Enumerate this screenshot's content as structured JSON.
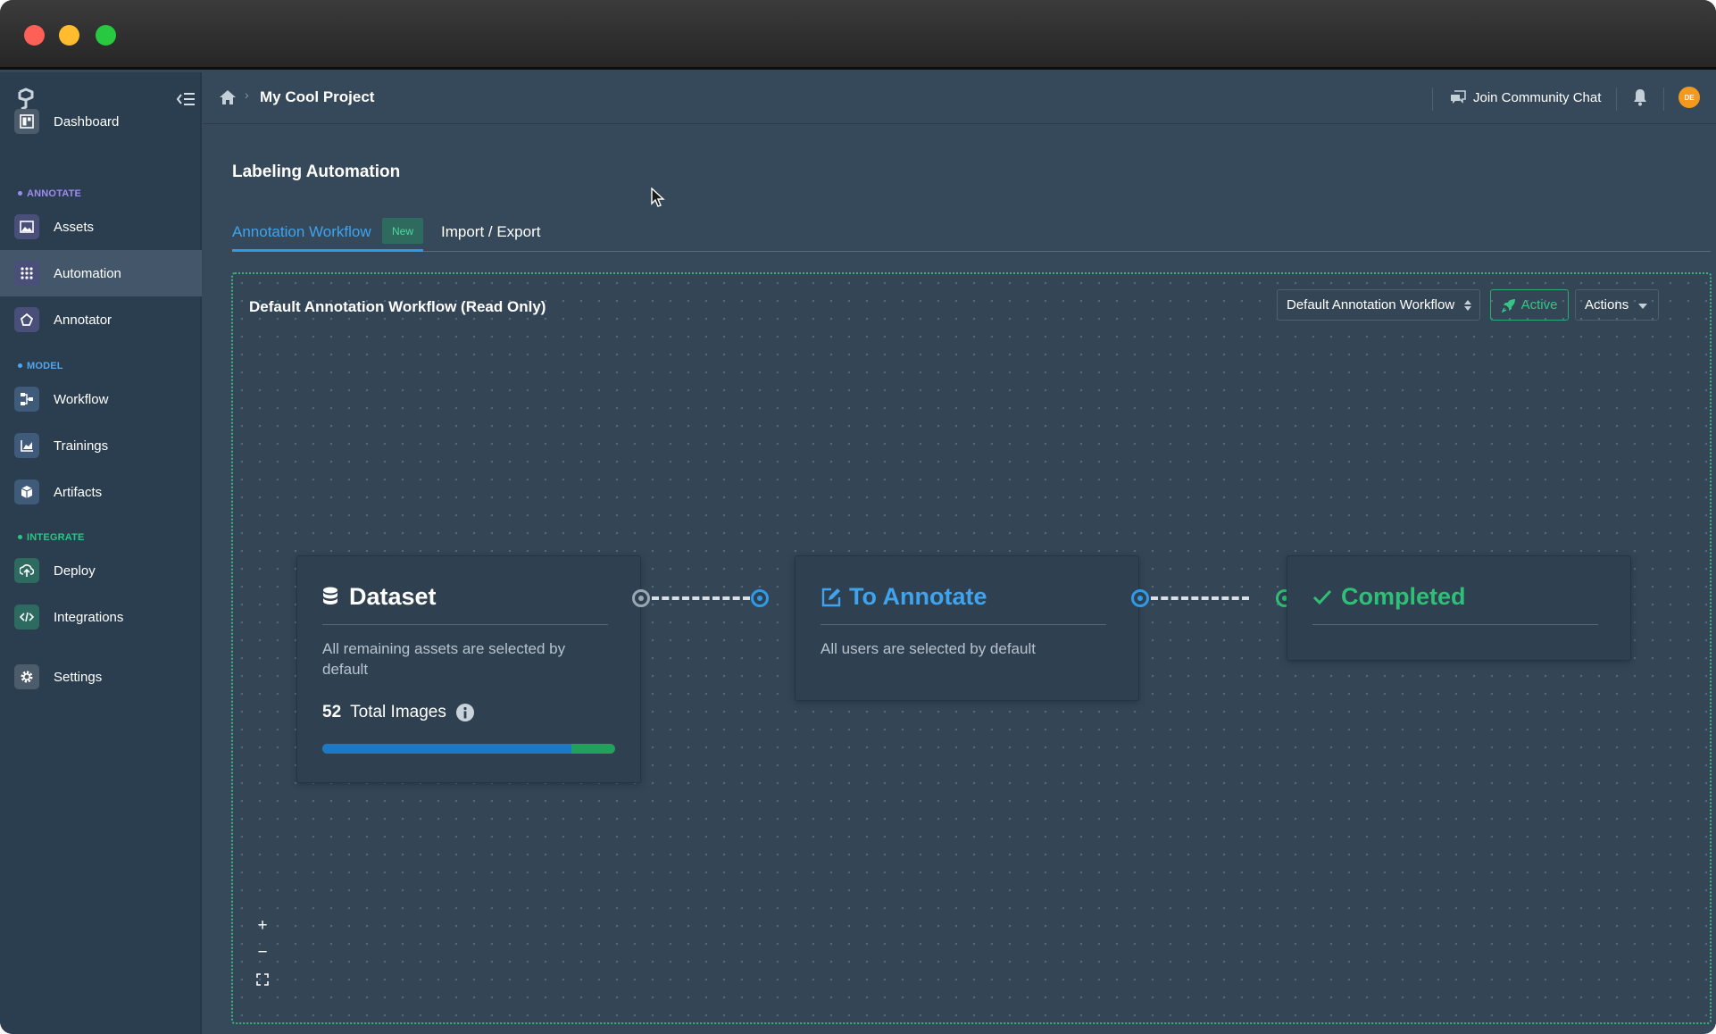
{
  "sidebar": {
    "dashboard": "Dashboard",
    "sections": {
      "annotate": "ANNOTATE",
      "model": "MODEL",
      "integrate": "INTEGRATE"
    },
    "items": {
      "assets": "Assets",
      "automation": "Automation",
      "annotator": "Annotator",
      "workflow": "Workflow",
      "trainings": "Trainings",
      "artifacts": "Artifacts",
      "deploy": "Deploy",
      "integrations": "Integrations",
      "settings": "Settings"
    },
    "active_item": "Automation"
  },
  "topbar": {
    "project_name": "My Cool Project",
    "community_chat": "Join Community Chat",
    "avatar_initials": "DE"
  },
  "page": {
    "title": "Labeling Automation",
    "tabs": {
      "annotation_workflow": "Annotation Workflow",
      "new_badge": "New",
      "import_export": "Import / Export"
    }
  },
  "workflow": {
    "title": "Default Annotation Workflow  (Read Only)",
    "select_value": "Default Annotation Workflow",
    "active_label": "Active",
    "actions_label": "Actions",
    "nodes": {
      "dataset": {
        "title": "Dataset",
        "description": "All remaining assets are selected by default",
        "count": "52",
        "count_label": "Total Images",
        "progress_fraction": 0.85
      },
      "to_annotate": {
        "title": "To Annotate",
        "description": "All users are selected by default"
      },
      "completed": {
        "title": "Completed"
      }
    },
    "zoom_controls": {
      "zoom_in": "+",
      "zoom_out": "−"
    }
  },
  "colors": {
    "accent_blue": "#3fa3ed",
    "success_green": "#2fbf76",
    "sidebar_bg": "#2b3e4f",
    "main_bg": "#35495a",
    "node_bg": "#2f4050",
    "progress_blue": "#1d79c4",
    "progress_green": "#22a05c",
    "avatar_orange": "#f39a1e"
  },
  "icons": {
    "logo": "logo-icon",
    "collapse": "collapse-sidebar-icon",
    "home": "home-icon",
    "chat": "chat-icon",
    "bell": "bell-icon",
    "database": "database-icon",
    "edit": "edit-icon",
    "check": "check-icon",
    "info": "info-icon",
    "rocket": "rocket-icon",
    "fit_view": "fit-view-icon"
  }
}
